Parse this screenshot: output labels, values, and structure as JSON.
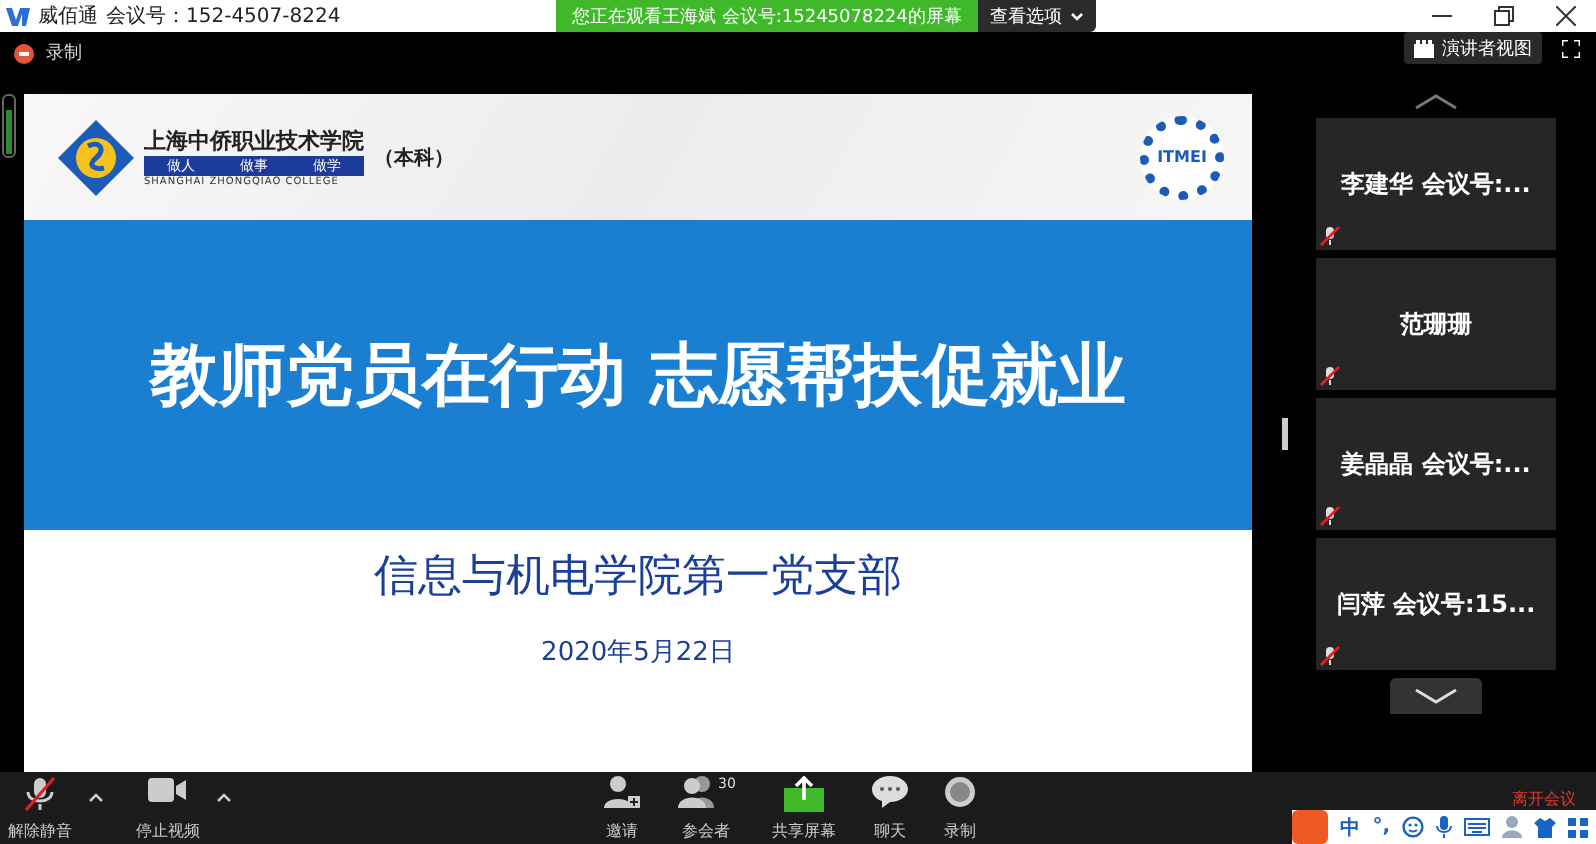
{
  "window": {
    "app_name": "威佰通",
    "meeting_id": "会议号：152-4507-8224"
  },
  "share_banner": {
    "text": "您正在观看王海斌  会议号:15245078224的屏幕",
    "button": "查看选项"
  },
  "recording": {
    "label": "录制"
  },
  "view_button": {
    "label": "演讲者视图"
  },
  "slide": {
    "school_name": "上海中侨职业技术学院",
    "motto": [
      "做人",
      "做事",
      "做学"
    ],
    "school_name_en": "SHANGHAI  ZHONGQIAO  COLLEGE",
    "degree": "（本科）",
    "badge": "ITMEI",
    "title": "教师党员在行动  志愿帮扶促就业",
    "subtitle": "信息与机电学院第一党支部",
    "date": "2020年5月22日"
  },
  "participants": [
    {
      "name": "李建华  会议号:...",
      "muted": true
    },
    {
      "name": "范珊珊",
      "muted": true
    },
    {
      "name": "姜晶晶  会议号:...",
      "muted": true
    },
    {
      "name": "闫萍  会议号:15...",
      "muted": true
    }
  ],
  "toolbar": [
    {
      "kind": "mic",
      "label": "解除静音",
      "caret": true,
      "muted": true
    },
    {
      "kind": "video",
      "label": "停止视频",
      "caret": true
    },
    {
      "kind": "invite",
      "label": "邀请"
    },
    {
      "kind": "participants",
      "label": "参会者",
      "count": "30"
    },
    {
      "kind": "share",
      "label": "共享屏幕"
    },
    {
      "kind": "chat",
      "label": "聊天"
    },
    {
      "kind": "record",
      "label": "录制"
    }
  ],
  "leave": "离开会议",
  "ime": {
    "mode": "中",
    "punct": "°,"
  }
}
